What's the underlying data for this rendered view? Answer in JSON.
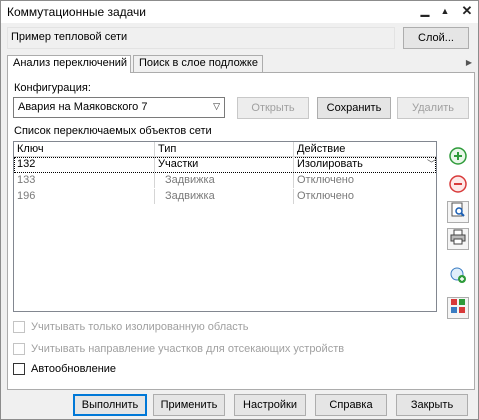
{
  "window": {
    "title": "Коммутационные задачи"
  },
  "layer": {
    "name": "Пример тепловой сети",
    "button": "Слой..."
  },
  "tabs": [
    {
      "label": "Анализ переключений"
    },
    {
      "label": "Поиск в слое подложке"
    }
  ],
  "config": {
    "label": "Конфигурация:",
    "selected": "Авария на Маяковского 7",
    "open_btn": "Открыть",
    "save_btn": "Сохранить",
    "delete_btn": "Удалить"
  },
  "list": {
    "label": "Список переключаемых объектов сети",
    "columns": [
      "Ключ",
      "Тип",
      "Действие"
    ],
    "rows": [
      {
        "key": "132",
        "type": "Участки",
        "action": "Изолировать"
      },
      {
        "key": "133",
        "type": "Задвижка",
        "action": "Отключено"
      },
      {
        "key": "196",
        "type": "Задвижка",
        "action": "Отключено"
      }
    ]
  },
  "options": {
    "isolated_only": "Учитывать только изолированную область",
    "direction": "Учитывать направление участков для отсекающих устройств",
    "auto_update": "Автообновление"
  },
  "footer": {
    "run": "Выполнить",
    "apply": "Применить",
    "settings": "Настройки",
    "help": "Справка",
    "close": "Закрыть"
  },
  "icons": [
    "add-icon",
    "remove-icon",
    "zoom-icon",
    "print-icon",
    "add-layer-icon",
    "grid-settings-icon"
  ]
}
